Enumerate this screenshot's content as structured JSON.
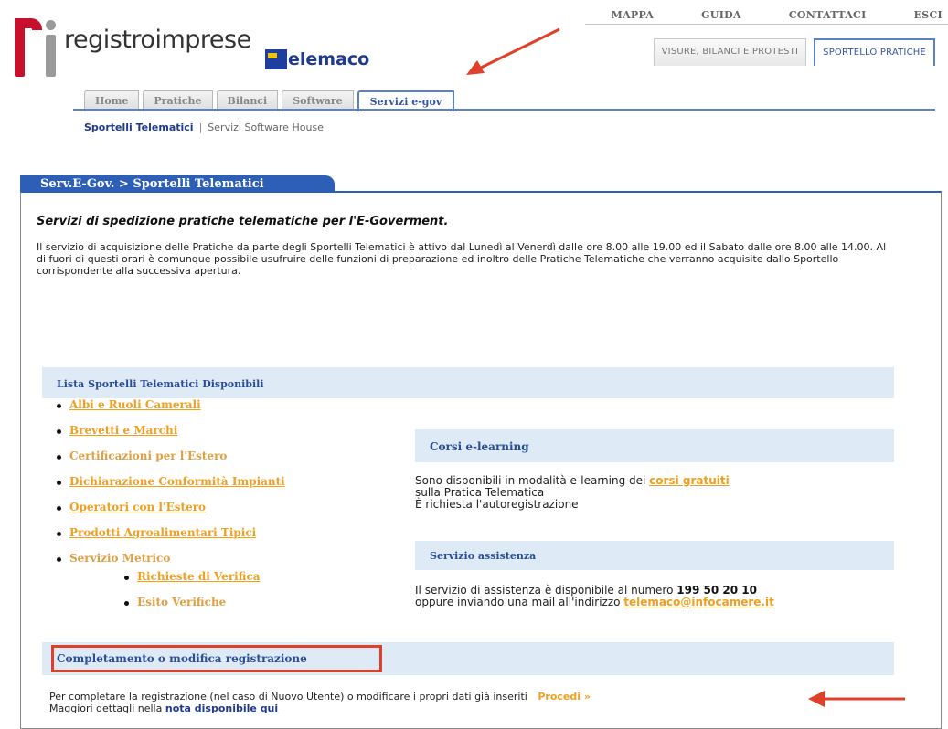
{
  "brand": {
    "logo_text": "registroimprese",
    "telemaco": "elemaco"
  },
  "toplinks": [
    "MAPPA",
    "GUIDA",
    "CONTATTACI",
    "ESCI"
  ],
  "right_tabs": [
    "VISURE, BILANCI E PROTESTI",
    "SPORTELLO PRATICHE"
  ],
  "tabs": [
    "Home",
    "Pratiche",
    "Bilanci",
    "Software",
    "Servizi e-gov"
  ],
  "subnav": {
    "active": "Sportelli Telematici",
    "sep": "|",
    "other": "Servizi Software House"
  },
  "section_tab": "Serv.E-Gov. > Sportelli Telematici",
  "intro": {
    "title": "Servizi di spedizione pratiche telematiche per l'E-Goverment.",
    "text": "Il servizio di acquisizione delle Pratiche da parte degli Sportelli Telematici è attivo dal Lunedì al Venerdì dalle ore 8.00 alle 19.00 ed il Sabato dalle ore 8.00 alle 14.00. Al di fuori di questi orari è comunque possibile usufruire delle funzioni di preparazione ed inoltro delle Pratiche Telematiche che verranno acquisite dallo Sportello corrispondente alla successiva apertura."
  },
  "lista": {
    "header": "Lista Sportelli Telematici Disponibili",
    "items": [
      "Albi e Ruoli Camerali",
      "Brevetti e Marchi",
      "Certificazioni per l'Estero",
      "Dichiarazione Conformità Impianti",
      "Operatori con l'Estero",
      "Prodotti Agroalimentari Tipici",
      "Servizio Metrico"
    ],
    "sub_items": [
      "Richieste di Verifica",
      "Esito Verifiche"
    ]
  },
  "corsi": {
    "header": "Corsi e-learning",
    "line1_pre": "Sono disponibili in modalità e-learning dei ",
    "line1_link": "corsi gratuiti",
    "line2": "sulla Pratica Telematica",
    "line3": "È richiesta l'autoregistrazione"
  },
  "assistenza": {
    "header": "Servizio assistenza",
    "line1_pre": "Il servizio di assistenza è disponibile al numero ",
    "phone": "199 50 20 10",
    "line2_pre": "oppure inviando una mail all'indirizzo ",
    "email": "telemaco@infocamere.it"
  },
  "completamento": {
    "header": "Completamento o modifica registrazione",
    "line1": "Per completare la registrazione (nel caso di Nuovo Utente) o modificare i propri dati già inseriti",
    "procedi": "Procedi »",
    "line2_pre": "Maggiori dettagli nella ",
    "line2_link": "nota disponibile qui"
  },
  "colors": {
    "accent_blue": "#2c5fb5",
    "link_orange": "#f0a020",
    "band": "#deebf6",
    "annotation_red": "#e0402a"
  }
}
